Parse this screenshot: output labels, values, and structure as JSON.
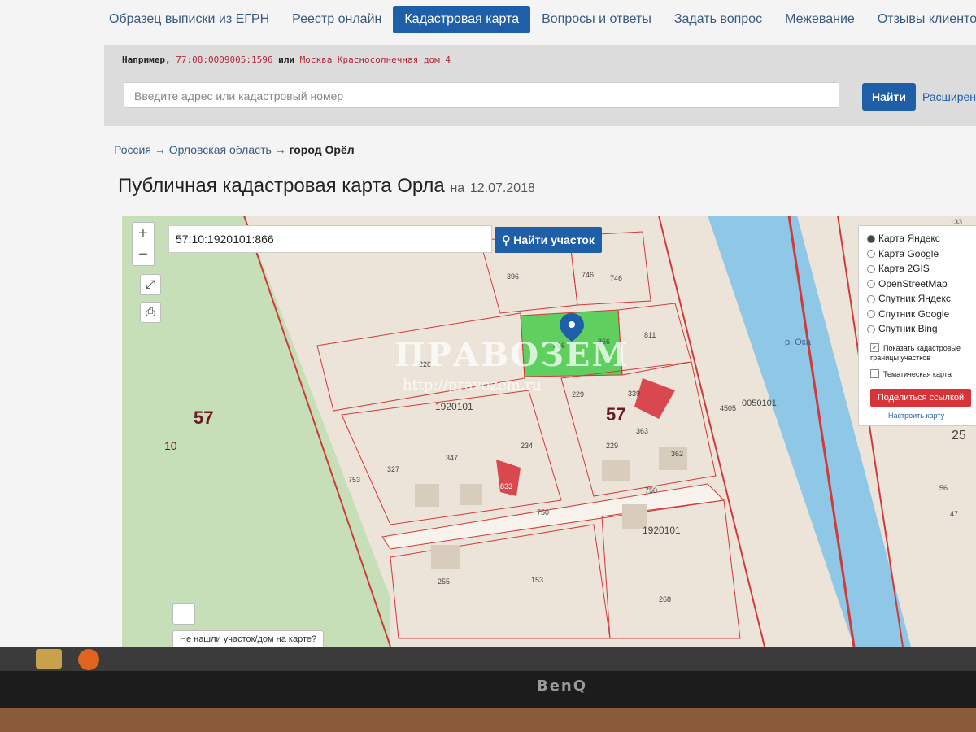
{
  "nav": {
    "items": [
      {
        "label": "Образец выписки из ЕГРН",
        "active": false
      },
      {
        "label": "Реестр онлайн",
        "active": false
      },
      {
        "label": "Кадастровая карта",
        "active": true
      },
      {
        "label": "Вопросы и ответы",
        "active": false
      },
      {
        "label": "Задать вопрос",
        "active": false
      },
      {
        "label": "Межевание",
        "active": false
      },
      {
        "label": "Отзывы клиентов",
        "active": false
      }
    ]
  },
  "search": {
    "example_prefix": "Например,",
    "example_number": "77:08:0009005:1596",
    "example_or": "или",
    "example_address": "Москва Красносолнечная дом 4",
    "placeholder": "Введите адрес или кадастровый номер",
    "button_label": "Найти",
    "extended_link": "Расширен"
  },
  "breadcrumb": {
    "country": "Россия",
    "arrow1": "→",
    "region": "Орловская область",
    "arrow2": "→",
    "city": "город Орёл"
  },
  "page": {
    "title": "Публичная кадастровая карта Орла",
    "date_prefix": "на",
    "date": "12.07.2018"
  },
  "map": {
    "zoom_in": "+",
    "zoom_out": "−",
    "cadastral_value": "57:10:1920101:866",
    "find_parcel_label": "Найти участок",
    "layers": [
      {
        "label": "Карта Яндекс",
        "selected": true
      },
      {
        "label": "Карта Google",
        "selected": false
      },
      {
        "label": "Карта 2GIS",
        "selected": false
      },
      {
        "label": "OpenStreetMap",
        "selected": false
      },
      {
        "label": "Спутник Яндекс",
        "selected": false
      },
      {
        "label": "Спутник Google",
        "selected": false
      },
      {
        "label": "Спутник Bing",
        "selected": false
      }
    ],
    "show_borders_label": "Показать кадастровые границы участков",
    "thematic_label": "Тематическая карта",
    "share_label": "Поделиться ссылкой",
    "setup_label": "Настроить карту",
    "not_found_label": "Не нашли участок/дом на карте?",
    "watermark": "ПРАВОЗЕМ",
    "watermark_url": "http://pravozem.ru",
    "parcel_labels": [
      "396",
      "746",
      "746",
      "811",
      "826",
      "866",
      "866",
      "229",
      "339",
      "1920101",
      "57",
      "234",
      "229",
      "363",
      "362",
      "327",
      "347",
      "833",
      "750",
      "750",
      "1920101",
      "255",
      "153",
      "268",
      "0050101",
      "4505",
      "753",
      "25",
      "56",
      "47",
      "133",
      "57",
      "10",
      "р. Ока"
    ],
    "river_label": "р. Ока",
    "colors": {
      "river": "#8fc7e6",
      "park": "#c6dfb9",
      "selected_parcel": "#5fcf5f",
      "border": "#d03a3a",
      "marker": "#1e5fa8"
    }
  },
  "monitor": {
    "brand": "BenQ"
  }
}
